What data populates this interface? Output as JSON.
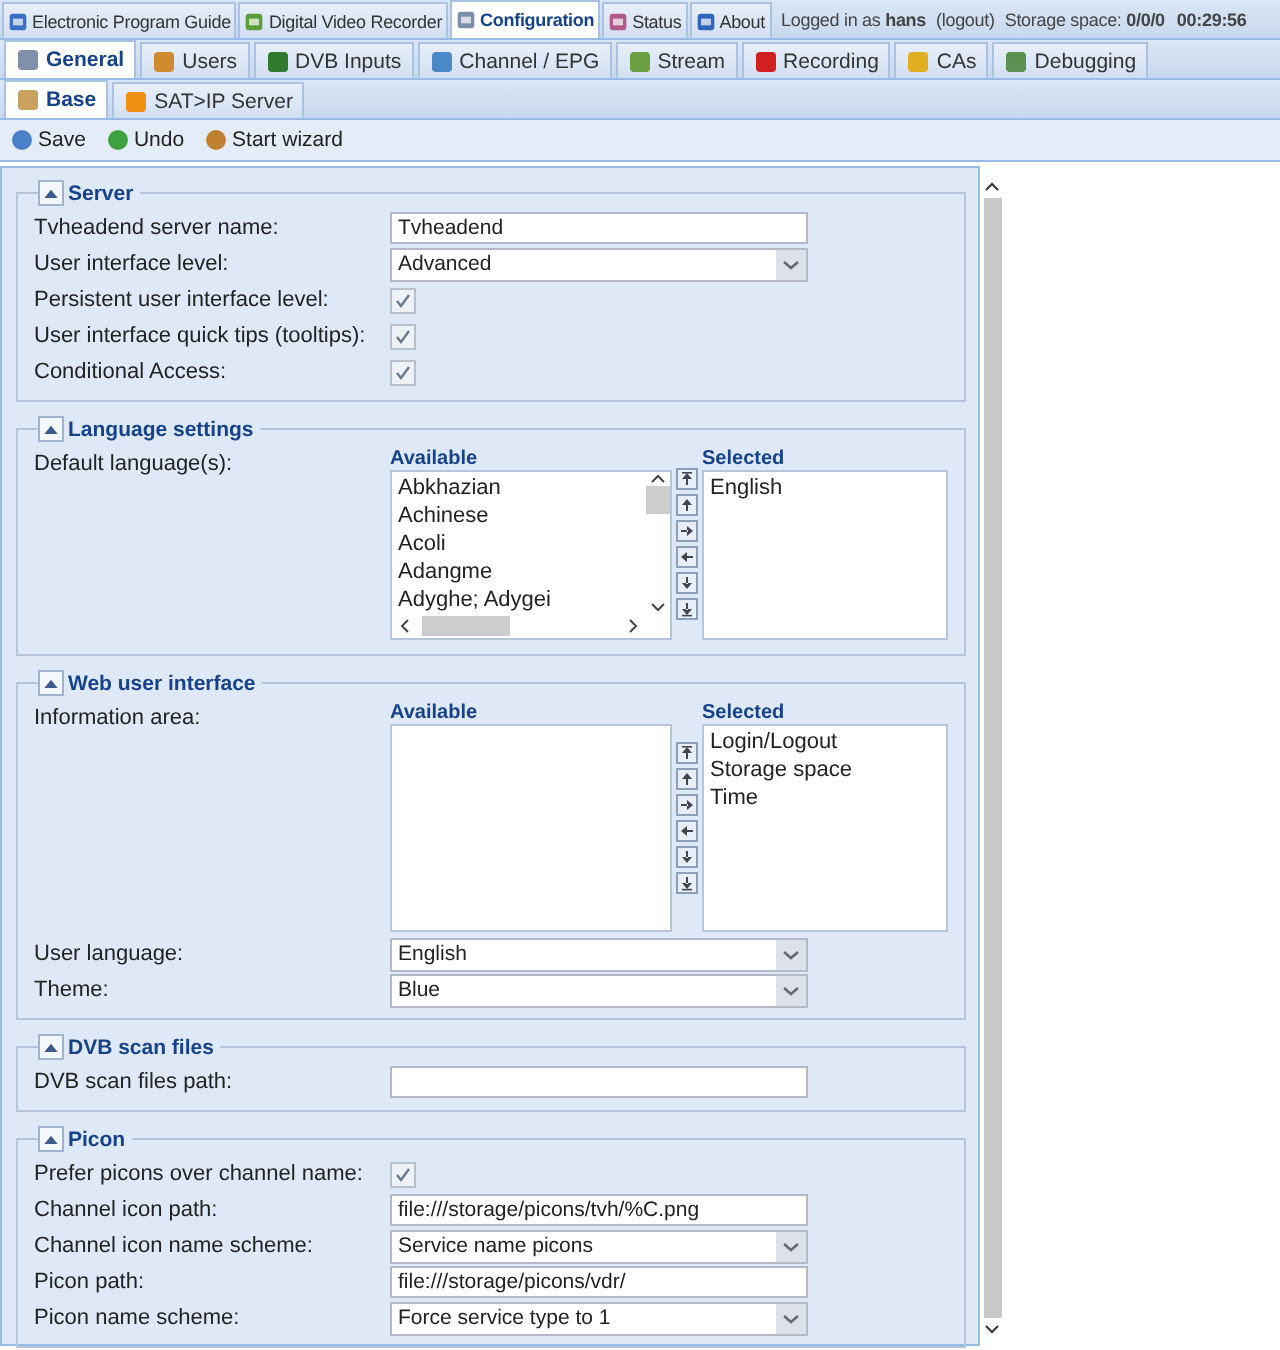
{
  "main_tabs": [
    {
      "label": "Electronic Program Guide",
      "selected": false
    },
    {
      "label": "Digital Video Recorder",
      "selected": false
    },
    {
      "label": "Configuration",
      "selected": true
    },
    {
      "label": "Status",
      "selected": false
    },
    {
      "label": "About",
      "selected": false
    }
  ],
  "info": {
    "logged_prefix": "Logged in as",
    "user": "hans",
    "logout": "(logout)",
    "storage_label": "Storage space:",
    "storage_value": "0/0/0",
    "time": "00:29:56"
  },
  "sub_tabs": [
    {
      "label": "General",
      "selected": true
    },
    {
      "label": "Users",
      "selected": false
    },
    {
      "label": "DVB Inputs",
      "selected": false
    },
    {
      "label": "Channel / EPG",
      "selected": false
    },
    {
      "label": "Stream",
      "selected": false
    },
    {
      "label": "Recording",
      "selected": false
    },
    {
      "label": "CAs",
      "selected": false
    },
    {
      "label": "Debugging",
      "selected": false
    }
  ],
  "page_tabs": [
    {
      "label": "Base",
      "selected": true
    },
    {
      "label": "SAT>IP Server",
      "selected": false
    }
  ],
  "toolbar": [
    "Save",
    "Undo",
    "Start wizard"
  ],
  "sections": [
    {
      "title": "Server",
      "expanded": true,
      "fields": [
        {
          "kind": "text",
          "label": "Tvheadend server name:",
          "value": "Tvheadend"
        },
        {
          "kind": "select",
          "label": "User interface level:",
          "value": "Advanced"
        },
        {
          "kind": "checkbox",
          "label": "Persistent user interface level:",
          "checked": true
        },
        {
          "kind": "checkbox",
          "label": "User interface quick tips (tooltips):",
          "checked": true
        },
        {
          "kind": "checkbox",
          "label": "Conditional Access:",
          "checked": true
        }
      ]
    },
    {
      "title": "Language settings",
      "expanded": true,
      "fields": [
        {
          "kind": "duallist",
          "label": "Default language(s):",
          "available_title": "Available",
          "selected_title": "Selected",
          "scrollbars": true,
          "available": [
            "Abkhazian",
            "Achinese",
            "Acoli",
            "Adangme",
            "Adyghe; Adygei"
          ],
          "chosen": [
            "English"
          ]
        }
      ]
    },
    {
      "title": "Web user interface",
      "expanded": true,
      "fields": [
        {
          "kind": "duallist",
          "label": "Information area:",
          "available_title": "Available",
          "selected_title": "Selected",
          "scrollbars": false,
          "chosen": [
            "Login/Logout",
            "Storage space",
            "Time"
          ]
        },
        {
          "kind": "select",
          "label": "User language:",
          "value": "English"
        },
        {
          "kind": "select",
          "label": "Theme:",
          "value": "Blue"
        }
      ]
    },
    {
      "title": "DVB scan files",
      "expanded": true,
      "fields": [
        {
          "kind": "text",
          "label": "DVB scan files path:"
        }
      ]
    },
    {
      "title": "Picon",
      "expanded": true,
      "fields": [
        {
          "kind": "checkbox",
          "label": "Prefer picons over channel name:",
          "checked": true
        },
        {
          "kind": "text",
          "label": "Channel icon path:",
          "value": "file:///storage/picons/tvh/%C.png"
        },
        {
          "kind": "select",
          "label": "Channel icon name scheme:",
          "value": "Service name picons"
        },
        {
          "kind": "text",
          "label": "Picon path:",
          "value": "file:///storage/picons/vdr/"
        },
        {
          "kind": "select",
          "label": "Picon name scheme:",
          "value": "Force service type to 1"
        }
      ]
    }
  ]
}
